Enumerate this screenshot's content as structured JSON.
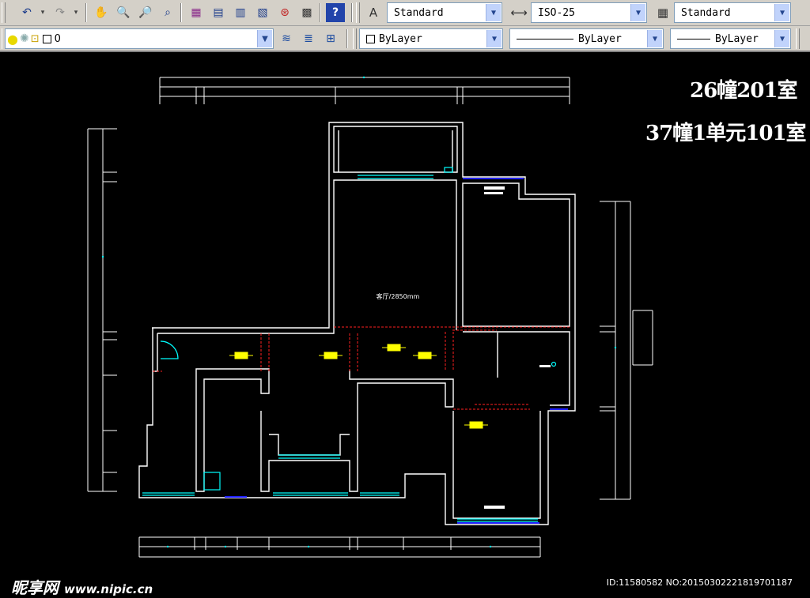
{
  "toolbar": {
    "text_style": "Standard",
    "dim_style": "ISO-25",
    "table_style": "Standard",
    "layer": "0",
    "color": "ByLayer",
    "linetype": "ByLayer",
    "lineweight": "ByLayer"
  },
  "drawing": {
    "title_line1": "26幢201室",
    "title_line2": "37幢1单元101室",
    "room_label_living": "客厅/2850mm",
    "colors": {
      "background": "#000000",
      "walls": "#ffffff",
      "windows": "#00ffff",
      "doors": "#0000ff",
      "hidden_lines": "#ff0000",
      "fixtures": "#ffff00"
    }
  },
  "watermark": {
    "brand": "昵享网",
    "url": "www.nipic.cn",
    "id_text": "ID:11580582 NO:20150302221819701187"
  }
}
